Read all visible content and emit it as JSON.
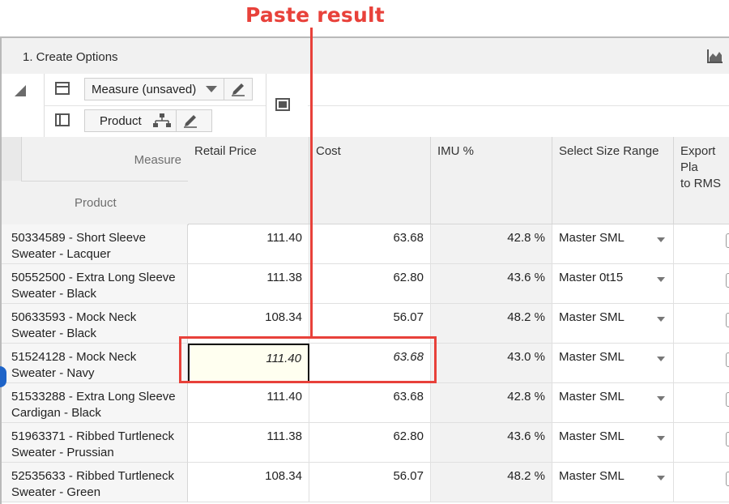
{
  "annotation": {
    "label": "Paste result"
  },
  "panel": {
    "title": "1. Create Options"
  },
  "pivot": {
    "measure_pill": "Measure (unsaved)",
    "product_pill": "Product"
  },
  "grid": {
    "corner_measure": "Measure",
    "corner_product": "Product",
    "columns": [
      "Retail Price",
      "Cost",
      "IMU %",
      "Select Size Range",
      "Export Pla\nto RMS"
    ],
    "rows": [
      {
        "product": "50334589 - Short Sleeve Sweater - Lacquer",
        "retail": "111.40",
        "cost": "63.68",
        "imu": "42.8 %",
        "size": "Master SML"
      },
      {
        "product": "50552500 - Extra Long Sleeve Sweater - Black",
        "retail": "111.38",
        "cost": "62.80",
        "imu": "43.6 %",
        "size": "Master 0t15"
      },
      {
        "product": "50633593 - Mock Neck Sweater - Black",
        "retail": "108.34",
        "cost": "56.07",
        "imu": "48.2 %",
        "size": "Master SML"
      },
      {
        "product": "51524128 - Mock Neck Sweater - Navy",
        "retail": "111.40",
        "cost": "63.68",
        "imu": "43.0 %",
        "size": "Master SML"
      },
      {
        "product": "51533288 - Extra Long Sleeve Cardigan - Black",
        "retail": "111.40",
        "cost": "63.68",
        "imu": "42.8 %",
        "size": "Master SML"
      },
      {
        "product": "51963371 - Ribbed Turtleneck Sweater - Prussian",
        "retail": "111.38",
        "cost": "62.80",
        "imu": "43.6 %",
        "size": "Master SML"
      },
      {
        "product": "52535633 - Ribbed Turtleneck Sweater - Green",
        "retail": "108.34",
        "cost": "56.07",
        "imu": "48.2 %",
        "size": "Master SML"
      }
    ]
  },
  "colors": {
    "accent": "#e8413a",
    "header_bg": "#f1f1f1",
    "active_cell_bg": "#fffff0"
  }
}
